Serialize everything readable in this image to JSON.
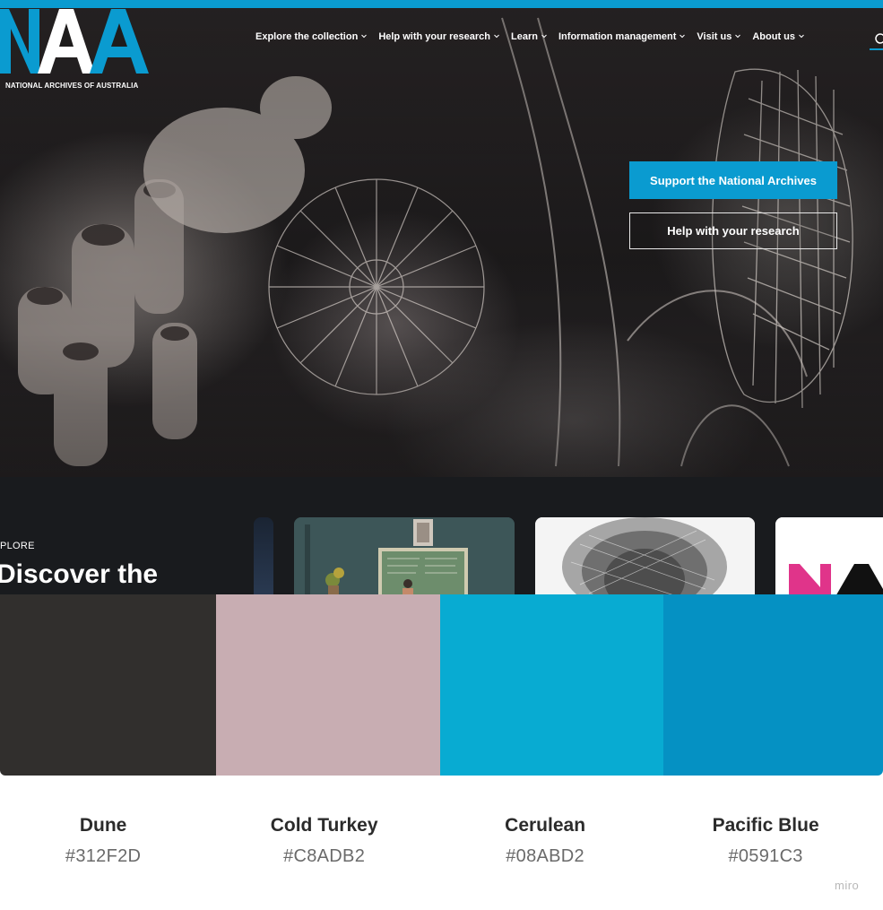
{
  "site": {
    "logo_letters": "NAA",
    "logo_caption": "NATIONAL ARCHIVES OF AUSTRALIA",
    "nav": [
      {
        "label": "Explore the collection"
      },
      {
        "label": "Help with your research"
      },
      {
        "label": "Learn"
      },
      {
        "label": "Information management"
      },
      {
        "label": "Visit us"
      },
      {
        "label": "About us"
      }
    ],
    "buttons": {
      "support": "Support the National Archives",
      "help": "Help with your research"
    },
    "explore": {
      "eyebrow": "PLORE",
      "title": "Discover the"
    }
  },
  "palette": [
    {
      "name": "Dune",
      "hex": "#312F2D"
    },
    {
      "name": "Cold Turkey",
      "hex": "#C8ADB2"
    },
    {
      "name": "Cerulean",
      "hex": "#08ABD2"
    },
    {
      "name": "Pacific Blue",
      "hex": "#0591C3"
    }
  ],
  "watermark": "miro",
  "colors": {
    "brand_blue": "#0A9BD0",
    "hero_dark": "#1C1A1B",
    "explore_bg": "#191B1E",
    "logo_pink": "#E0348A"
  }
}
